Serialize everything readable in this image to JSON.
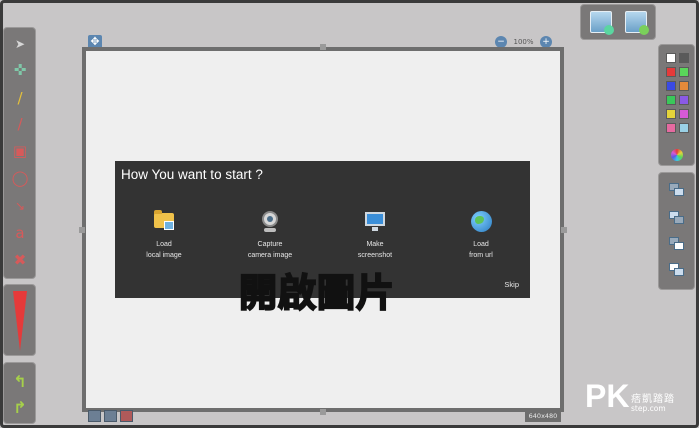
{
  "dialog": {
    "title": "How You want to start ?",
    "options": [
      {
        "line1": "Load",
        "line2": "local image",
        "icon": "folder-image-icon"
      },
      {
        "line1": "Capture",
        "line2": "camera image",
        "icon": "webcam-icon"
      },
      {
        "line1": "Make",
        "line2": "screenshot",
        "icon": "monitor-icon"
      },
      {
        "line1": "Load",
        "line2": "from url",
        "icon": "globe-icon"
      }
    ],
    "skip_label": "Skip"
  },
  "canvas": {
    "zoom": "100%",
    "size": "640x480"
  },
  "overlay_caption": "開啟圖片",
  "watermark": {
    "logo": "PK",
    "name": "痞凱踏踏",
    "site": "step.com"
  },
  "tools": {
    "text_tool_glyph": "a"
  },
  "colors": {
    "accent": "#e53a3a",
    "dialog_bg": "#333333",
    "caption": "#ff6a1a",
    "palette": [
      "#ffffff",
      "#5a5a5a",
      "#e53a3a",
      "#5ad65a",
      "#3a4ae5",
      "#e58a3a",
      "#3ac85a",
      "#8a5ae5",
      "#e5d43a",
      "#d65ad6",
      "#e56aa0",
      "#9ad0e5"
    ]
  }
}
